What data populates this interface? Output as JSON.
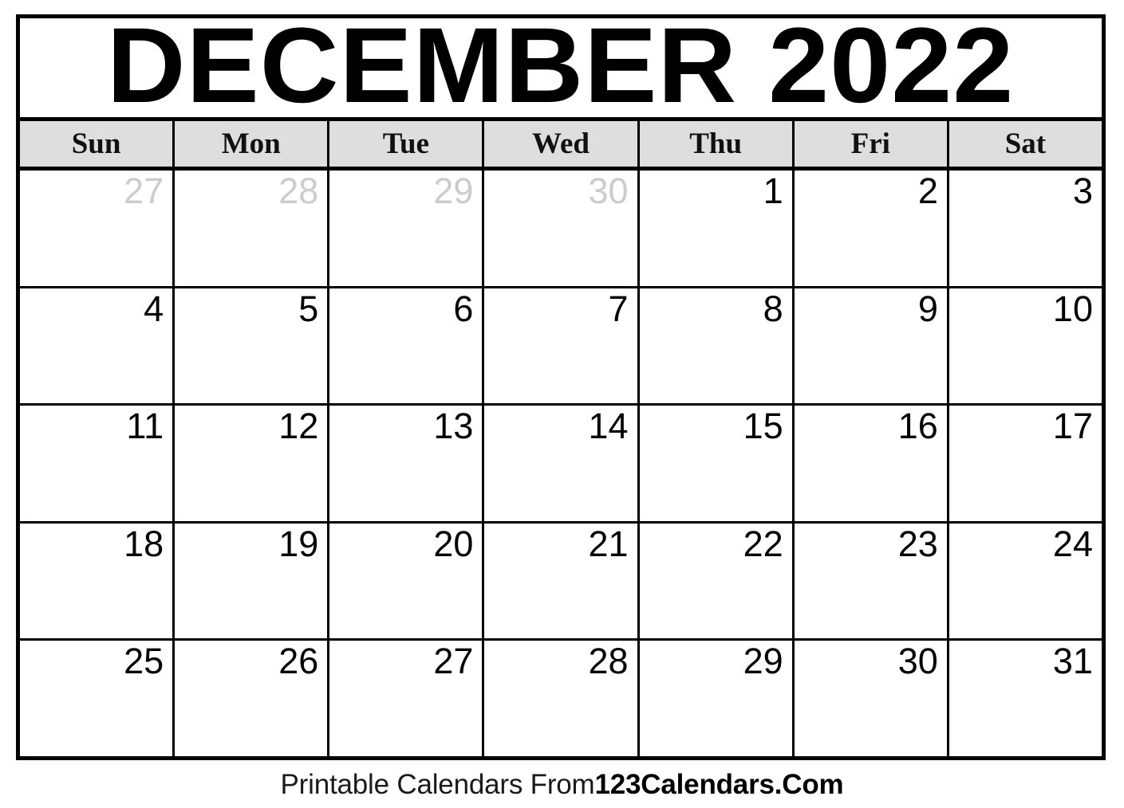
{
  "header": {
    "title": "DECEMBER 2022",
    "month_name": "DECEMBER",
    "year": "2022"
  },
  "weekdays": [
    {
      "label": "Sun"
    },
    {
      "label": "Mon"
    },
    {
      "label": "Tue"
    },
    {
      "label": "Wed"
    },
    {
      "label": "Thu"
    },
    {
      "label": "Fri"
    },
    {
      "label": "Sat"
    }
  ],
  "weeks": [
    {
      "days": [
        {
          "num": "27",
          "muted": true
        },
        {
          "num": "28",
          "muted": true
        },
        {
          "num": "29",
          "muted": true
        },
        {
          "num": "30",
          "muted": true
        },
        {
          "num": "1",
          "muted": false
        },
        {
          "num": "2",
          "muted": false
        },
        {
          "num": "3",
          "muted": false
        }
      ]
    },
    {
      "days": [
        {
          "num": "4",
          "muted": false
        },
        {
          "num": "5",
          "muted": false
        },
        {
          "num": "6",
          "muted": false
        },
        {
          "num": "7",
          "muted": false
        },
        {
          "num": "8",
          "muted": false
        },
        {
          "num": "9",
          "muted": false
        },
        {
          "num": "10",
          "muted": false
        }
      ]
    },
    {
      "days": [
        {
          "num": "11",
          "muted": false
        },
        {
          "num": "12",
          "muted": false
        },
        {
          "num": "13",
          "muted": false
        },
        {
          "num": "14",
          "muted": false
        },
        {
          "num": "15",
          "muted": false
        },
        {
          "num": "16",
          "muted": false
        },
        {
          "num": "17",
          "muted": false
        }
      ]
    },
    {
      "days": [
        {
          "num": "18",
          "muted": false
        },
        {
          "num": "19",
          "muted": false
        },
        {
          "num": "20",
          "muted": false
        },
        {
          "num": "21",
          "muted": false
        },
        {
          "num": "22",
          "muted": false
        },
        {
          "num": "23",
          "muted": false
        },
        {
          "num": "24",
          "muted": false
        }
      ]
    },
    {
      "days": [
        {
          "num": "25",
          "muted": false
        },
        {
          "num": "26",
          "muted": false
        },
        {
          "num": "27",
          "muted": false
        },
        {
          "num": "28",
          "muted": false
        },
        {
          "num": "29",
          "muted": false
        },
        {
          "num": "30",
          "muted": false
        },
        {
          "num": "31",
          "muted": false
        }
      ]
    }
  ],
  "footer": {
    "prefix": "Printable Calendars From ",
    "brand": "123Calendars.Com"
  },
  "colors": {
    "border": "#000000",
    "weekday_bg": "#dedede",
    "text": "#000000",
    "muted_text": "#cccccc",
    "page_bg": "#ffffff"
  }
}
